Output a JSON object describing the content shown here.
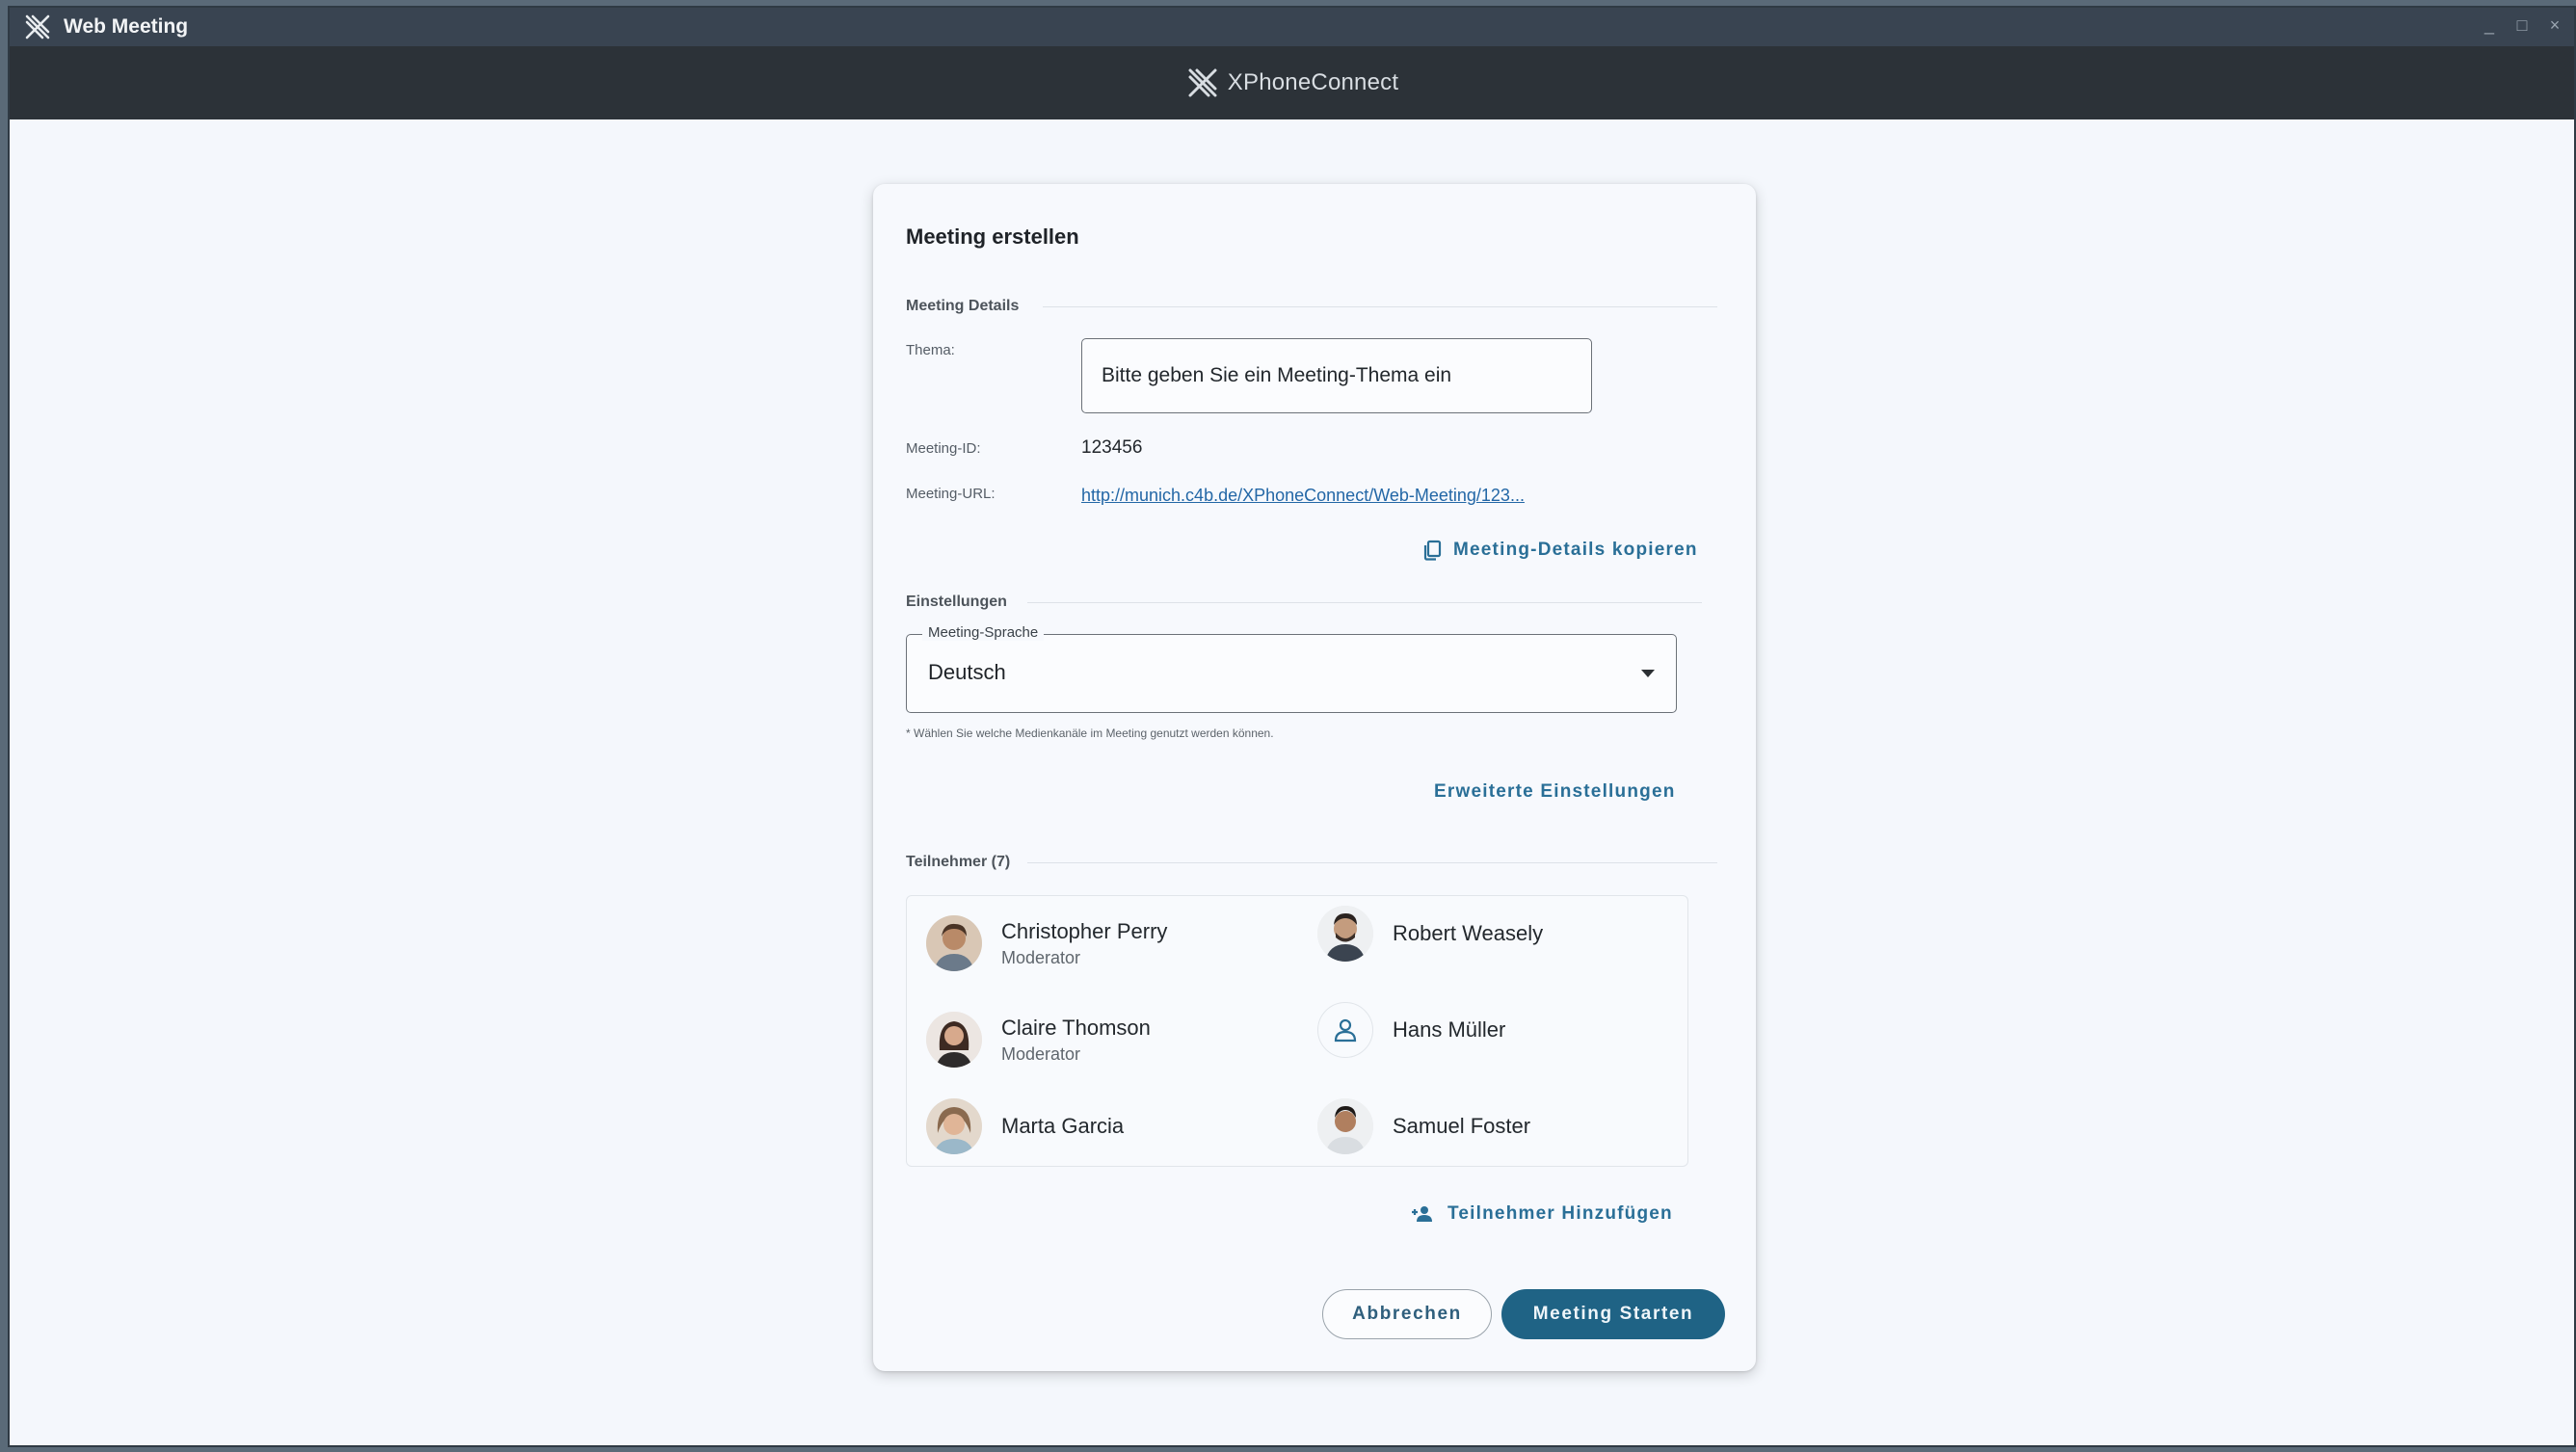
{
  "window": {
    "title": "Web Meeting",
    "controls": {
      "minimize": "_",
      "maximize": "□",
      "close": "×"
    }
  },
  "brand": {
    "name_part1": "XPhone",
    "name_part2": "Connect"
  },
  "dialog": {
    "title": "Meeting erstellen",
    "details_section": "Meeting Details",
    "topic_label": "Thema:",
    "topic_placeholder": "Bitte geben Sie ein Meeting-Thema ein",
    "topic_value": "",
    "id_label": "Meeting-ID:",
    "id_value": "123456",
    "url_label": "Meeting-URL:",
    "url_value": "http://munich.c4b.de/XPhoneConnect/Web-Meeting/123...",
    "copy_details": "Meeting-Details kopieren",
    "settings_section": "Einstellungen",
    "language_label": "Meeting-Sprache",
    "language_value": "Deutsch",
    "hint": "* Wählen Sie welche Medienkanäle im Meeting genutzt werden können.",
    "advanced_settings": "Erweiterte Einstellungen",
    "participants_section": "Teilnehmer (7)",
    "add_participant": "Teilnehmer Hinzufügen",
    "cancel": "Abbrechen",
    "start": "Meeting Starten"
  },
  "participants": [
    {
      "name": "Christopher Perry",
      "role": "Moderator",
      "avatar": "photo-avatar"
    },
    {
      "name": "Robert Weasely",
      "role": "",
      "avatar": "photo-avatar"
    },
    {
      "name": "Claire Thomson",
      "role": "Moderator",
      "avatar": "photo-avatar"
    },
    {
      "name": "Hans Müller",
      "role": "",
      "avatar": "person-icon"
    },
    {
      "name": "Marta Garcia",
      "role": "",
      "avatar": "photo-avatar"
    },
    {
      "name": "Samuel Foster",
      "role": "",
      "avatar": "photo-avatar"
    }
  ],
  "colors": {
    "accent": "#1f6385",
    "link": "#2367a6",
    "titlebar": "#394451",
    "brandbar": "#2c3238",
    "background": "#f4f7fc"
  }
}
